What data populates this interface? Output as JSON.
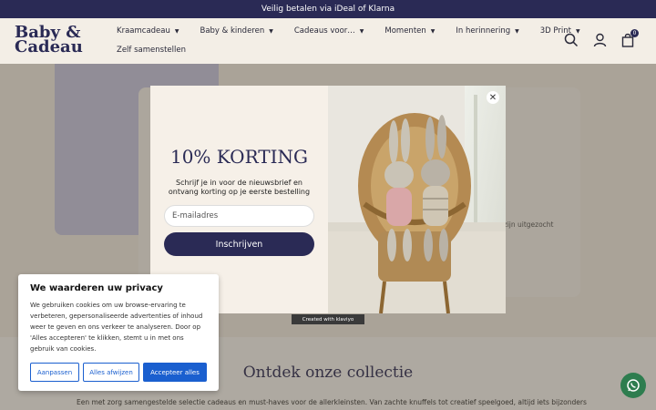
{
  "topbar": {
    "text": "Veilig betalen via iDeal of Klarna"
  },
  "header": {
    "logo_line1": "Baby &",
    "logo_line2": "Cadeau",
    "nav": [
      "Kraamcadeau",
      "Baby & kinderen",
      "Cadeaus voor…",
      "Momenten",
      "In herinnering",
      "3D Print"
    ],
    "nav_row2": "Zelf samenstellen",
    "cart_count": "0"
  },
  "hero": {
    "partial_text": "de zijn uitgezocht"
  },
  "popup": {
    "title": "10% KORTING",
    "subtitle": "Schrijf je in voor de nieuwsbrief en ontvang korting op je eerste bestelling",
    "email_placeholder": "E-mailadres",
    "subscribe_label": "Inschrijven",
    "close": "✕",
    "klaviyo": "Created with klaviyo"
  },
  "cookie": {
    "title": "We waarderen uw privacy",
    "body": "We gebruiken cookies om uw browse-ervaring te verbeteren, gepersonaliseerde advertenties of inhoud weer te geven en ons verkeer te analyseren. Door op 'Alles accepteren' te klikken, stemt u in met ons gebruik van cookies.",
    "customize": "Aanpassen",
    "reject": "Alles afwijzen",
    "accept": "Accepteer alles"
  },
  "collection": {
    "title": "Ontdek onze collectie",
    "text": "Een met zorg samengestelde selectie cadeaus en must-haves voor de allerkleinsten. Van zachte knuffels tot creatief speelgoed, altijd iets bijzonders om te"
  },
  "colors": {
    "brand": "#2a2a55",
    "cookie_button": "#1a5fcf",
    "chat": "#2e7d4f"
  },
  "icons": [
    "search-icon",
    "user-icon",
    "bag-icon",
    "close-icon",
    "whatsapp-icon"
  ]
}
